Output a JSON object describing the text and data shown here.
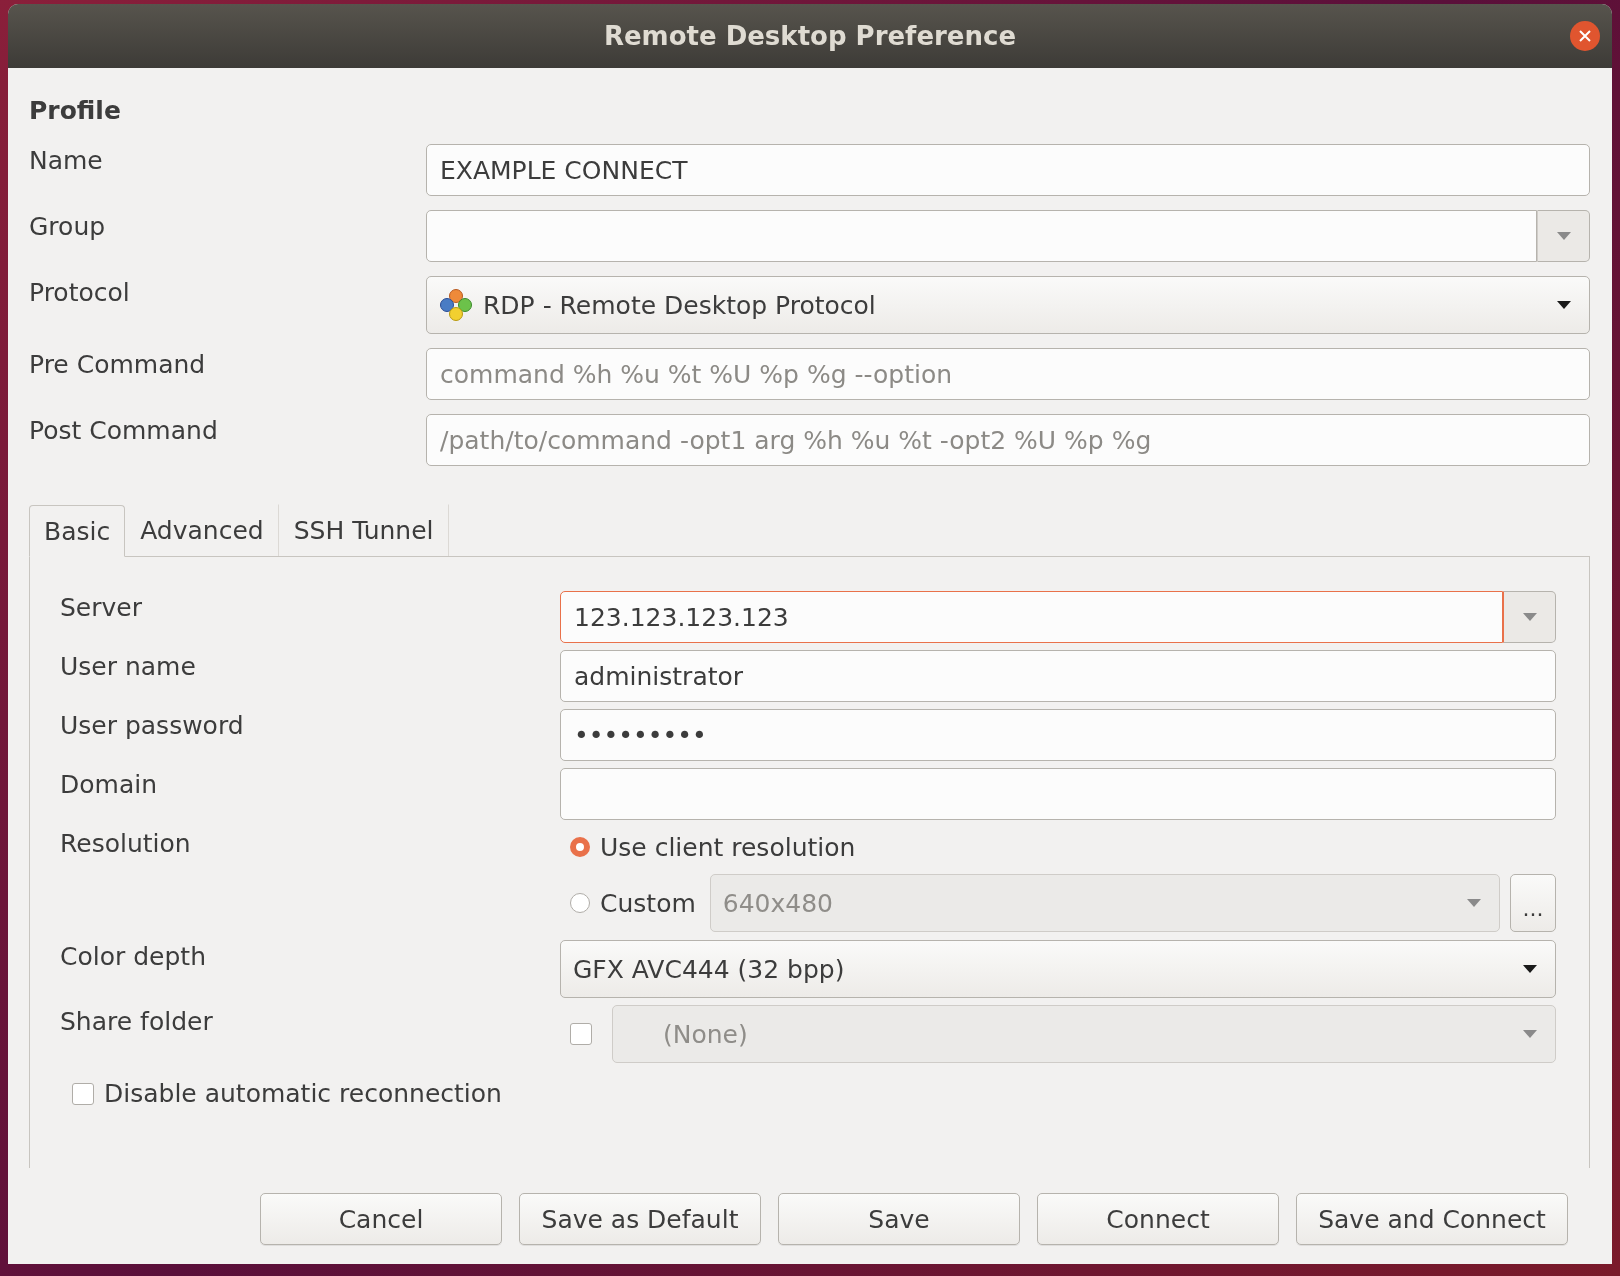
{
  "window": {
    "title": "Remote Desktop Preference"
  },
  "profile": {
    "heading": "Profile",
    "fields": [
      {
        "label": "Name",
        "kind": "entry",
        "value": "EXAMPLE CONNECT"
      },
      {
        "label": "Group",
        "kind": "combo_entry"
      },
      {
        "label": "Protocol",
        "kind": "icon_dropdown",
        "value": "RDP - Remote Desktop Protocol"
      },
      {
        "label": "Pre Command",
        "kind": "entry",
        "placeholder": "command %h %u %t %U %p %g --option"
      },
      {
        "label": "Post Command",
        "kind": "entry",
        "placeholder": "/path/to/command -opt1 arg %h %u %t -opt2 %U %p %g"
      }
    ]
  },
  "tabs": [
    {
      "label": "Basic",
      "selected": true
    },
    {
      "label": "Advanced",
      "selected": false
    },
    {
      "label": "SSH Tunnel",
      "selected": false
    }
  ],
  "basic": {
    "rows": [
      {
        "label": "Server",
        "kind": "combo_entry",
        "value": "123.123.123.123",
        "focused": true
      },
      {
        "label": "User name",
        "kind": "entry",
        "value": "administrator"
      },
      {
        "label": "User password",
        "kind": "entry",
        "value": "•••••••••"
      },
      {
        "label": "Domain",
        "kind": "entry"
      },
      {
        "label": "Resolution",
        "kind": "radios",
        "options": [
          {
            "label": "Use client resolution",
            "selected": true
          },
          {
            "label": "Custom",
            "selected": false,
            "value": "640x480",
            "disabled": true,
            "button": "..."
          }
        ]
      },
      {
        "label": "Color depth",
        "kind": "dropdown",
        "value": "GFX AVC444 (32 bpp)"
      },
      {
        "label": "Share folder",
        "kind": "check_dropdown",
        "checked": false,
        "value": "(None)",
        "disabled": true
      }
    ],
    "checkbox": {
      "label": "Disable automatic reconnection",
      "checked": false
    }
  },
  "buttons": [
    "Cancel",
    "Save as Default",
    "Save",
    "Connect",
    "Save and Connect"
  ]
}
